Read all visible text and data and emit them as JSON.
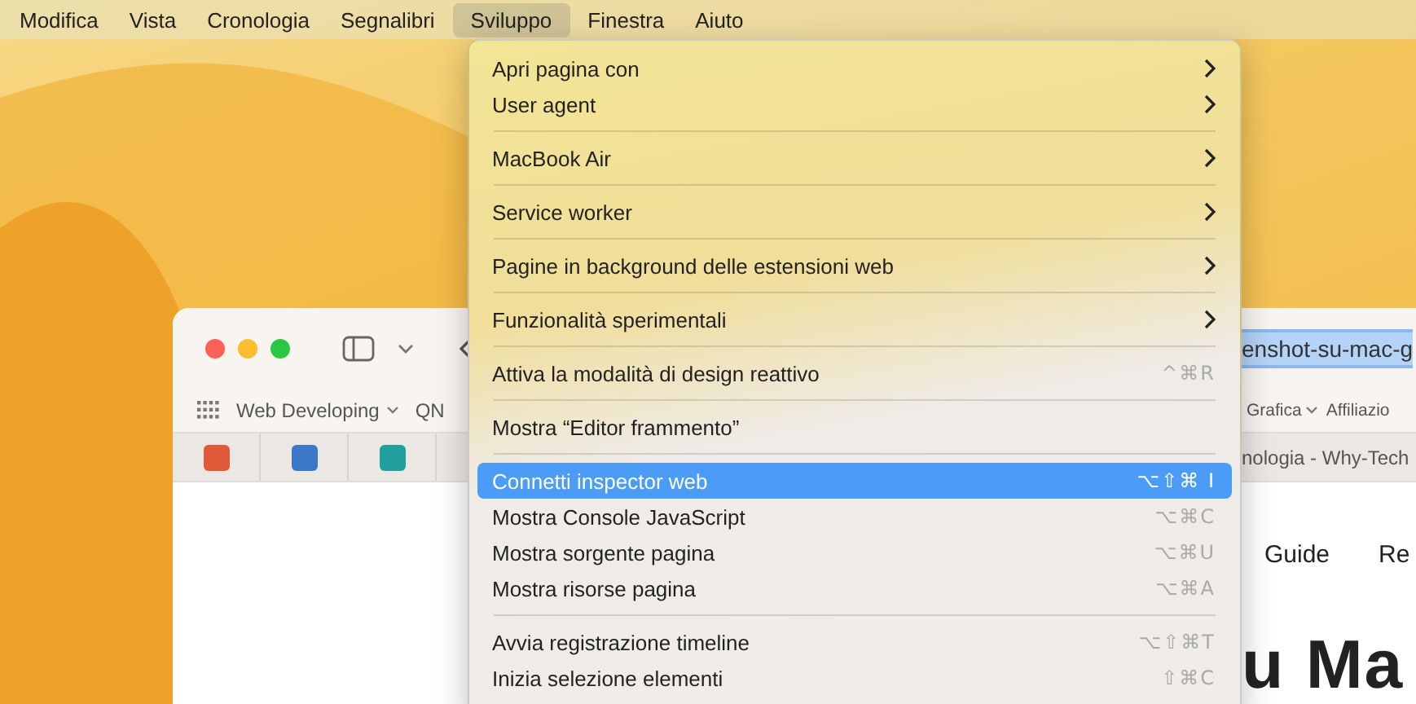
{
  "menu_bar": {
    "items": [
      {
        "label": "Modifica",
        "selected": false
      },
      {
        "label": "Vista",
        "selected": false
      },
      {
        "label": "Cronologia",
        "selected": false
      },
      {
        "label": "Segnalibri",
        "selected": false
      },
      {
        "label": "Sviluppo",
        "selected": true
      },
      {
        "label": "Finestra",
        "selected": false
      },
      {
        "label": "Aiuto",
        "selected": false
      }
    ]
  },
  "browser": {
    "address_text": "enshot-su-mac-g",
    "bookmarks_left": [
      {
        "label": "Web Developing",
        "has_dropdown": true
      },
      {
        "label": "QN",
        "has_dropdown": false
      }
    ],
    "bookmarks_right": [
      {
        "label": "Grafica",
        "has_dropdown": true
      },
      {
        "label": "Affiliazio",
        "has_dropdown": false
      }
    ],
    "tab_title": "nologia - Why-Tech",
    "nav_links": [
      "Guide",
      "Re"
    ],
    "heading": "u Ma"
  },
  "menu": {
    "groups": [
      [
        {
          "label": "Apri pagina con",
          "kind": "submenu",
          "selected": false
        },
        {
          "label": "User agent",
          "kind": "submenu",
          "selected": false
        }
      ],
      [
        {
          "label": "MacBook Air",
          "kind": "submenu",
          "selected": false
        }
      ],
      [
        {
          "label": "Service worker",
          "kind": "submenu",
          "selected": false
        }
      ],
      [
        {
          "label": "Pagine in background delle estensioni web",
          "kind": "submenu",
          "selected": false
        }
      ],
      [
        {
          "label": "Funzionalità sperimentali",
          "kind": "submenu",
          "selected": false
        }
      ],
      [
        {
          "label": "Attiva la modalità di design reattivo",
          "kind": "command",
          "shortcut": "^⌘R",
          "selected": false
        }
      ],
      [
        {
          "label": "Mostra “Editor frammento”",
          "kind": "command",
          "selected": false
        }
      ],
      [
        {
          "label": "Connetti inspector web",
          "kind": "command",
          "shortcut": "⌥⇧⌘ I",
          "selected": true
        },
        {
          "label": "Mostra Console JavaScript",
          "kind": "command",
          "shortcut": "⌥⌘C",
          "selected": false
        },
        {
          "label": "Mostra sorgente pagina",
          "kind": "command",
          "shortcut": "⌥⌘U",
          "selected": false
        },
        {
          "label": "Mostra risorse pagina",
          "kind": "command",
          "shortcut": "⌥⌘A",
          "selected": false
        }
      ],
      [
        {
          "label": "Avvia registrazione timeline",
          "kind": "command",
          "shortcut": "⌥⇧⌘T",
          "selected": false
        },
        {
          "label": "Inizia selezione elementi",
          "kind": "command",
          "shortcut": "⇧⌘C",
          "selected": false
        }
      ]
    ]
  }
}
